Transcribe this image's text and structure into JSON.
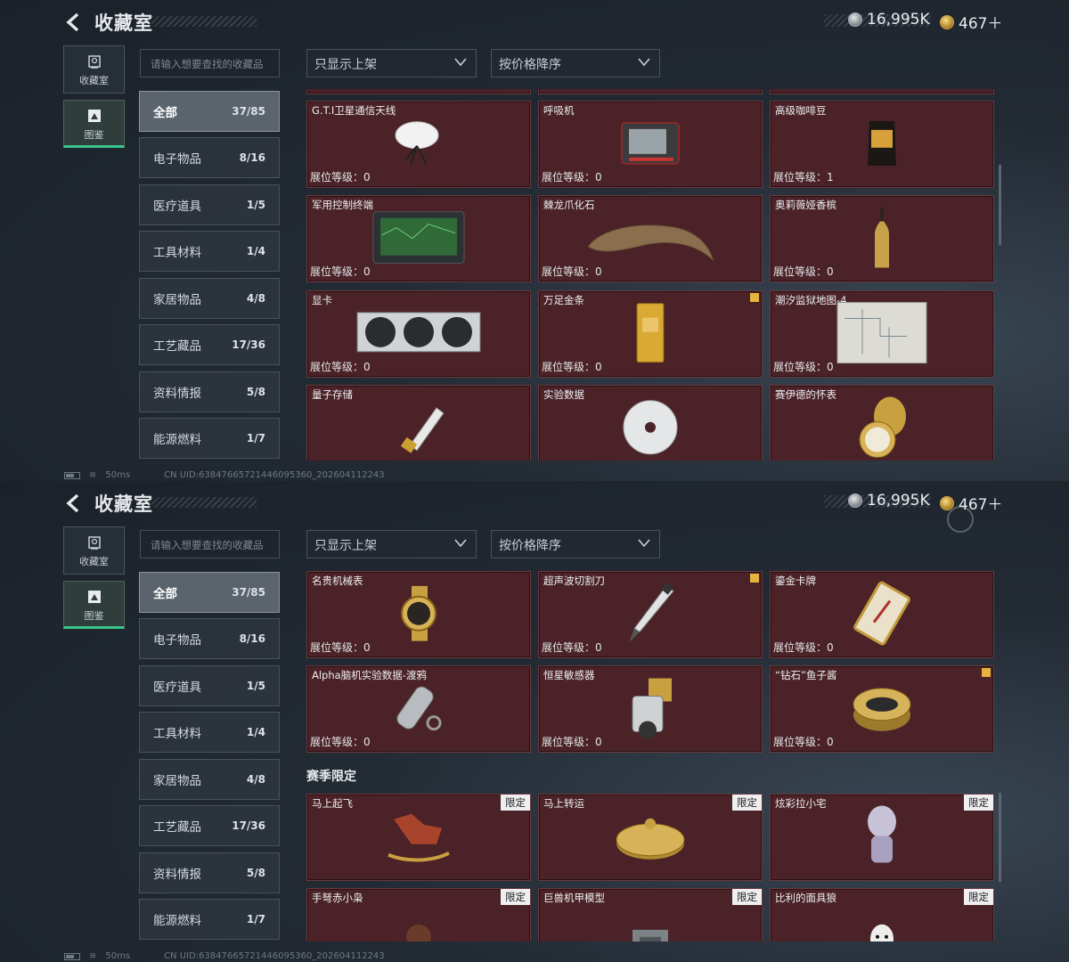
{
  "header": {
    "title": "收藏室",
    "silver_amount": "16,995K",
    "gold_amount": "467＋"
  },
  "left_nav": [
    {
      "label": "收藏室",
      "icon": "collection-room-icon"
    },
    {
      "label": "图鉴",
      "icon": "codex-icon"
    }
  ],
  "search": {
    "placeholder": "请输入想要查找的收藏品"
  },
  "filters": {
    "show_filter": "只显示上架",
    "sort": "按价格降序"
  },
  "categories": [
    {
      "label": "全部",
      "count": "37/85"
    },
    {
      "label": "电子物品",
      "count": "8/16"
    },
    {
      "label": "医疗道具",
      "count": "1/5"
    },
    {
      "label": "工具材料",
      "count": "1/4"
    },
    {
      "label": "家居物品",
      "count": "4/8"
    },
    {
      "label": "工艺藏品",
      "count": "17/36"
    },
    {
      "label": "资料情报",
      "count": "5/8"
    },
    {
      "label": "能源燃料",
      "count": "1/7"
    }
  ],
  "panel1_items": [
    {
      "name": "G.T.I卫星通信天线",
      "level": "展位等级：0",
      "icon": "satellite-dish-icon"
    },
    {
      "name": "呼吸机",
      "level": "展位等级：0",
      "icon": "ventilator-icon"
    },
    {
      "name": "高级咖啡豆",
      "level": "展位等级：1",
      "icon": "coffee-bag-icon"
    },
    {
      "name": "军用控制终端",
      "level": "展位等级：0",
      "icon": "terminal-icon"
    },
    {
      "name": "棘龙爪化石",
      "level": "展位等级：0",
      "icon": "claw-fossil-icon"
    },
    {
      "name": "奥莉薇娅香槟",
      "level": "展位等级：0",
      "icon": "champagne-icon"
    },
    {
      "name": "显卡",
      "level": "展位等级：0",
      "icon": "gpu-icon"
    },
    {
      "name": "万足金条",
      "level": "展位等级：0",
      "icon": "gold-bar-icon",
      "warn": true
    },
    {
      "name": "潮汐监狱地图-4",
      "level": "展位等级：0",
      "icon": "map-icon"
    },
    {
      "name": "量子存储",
      "level": "",
      "icon": "usb-drive-icon"
    },
    {
      "name": "实验数据",
      "level": "",
      "icon": "disc-icon"
    },
    {
      "name": "赛伊德的怀表",
      "level": "",
      "icon": "pocket-watch-icon"
    }
  ],
  "panel2_items": [
    {
      "name": "名贵机械表",
      "level": "展位等级：0",
      "icon": "wristwatch-icon"
    },
    {
      "name": "超声波切割刀",
      "level": "展位等级：0",
      "icon": "cutter-icon",
      "warn": true
    },
    {
      "name": "鎏金卡牌",
      "level": "展位等级：0",
      "icon": "gilded-card-icon"
    },
    {
      "name": "Alpha脑机实验数据-渡鸦",
      "level": "展位等级：0",
      "icon": "data-capsule-icon"
    },
    {
      "name": "恒星敏感器",
      "level": "展位等级：0",
      "icon": "sensor-icon"
    },
    {
      "name": "“钻石”鱼子酱",
      "level": "展位等级：0",
      "icon": "caviar-tin-icon",
      "warn": true
    }
  ],
  "season_title": "赛季限定",
  "limited_label": "限定",
  "season_items": [
    {
      "name": "马上起飞",
      "icon": "rocking-horse-icon"
    },
    {
      "name": "马上转运",
      "icon": "fortune-wheel-icon"
    },
    {
      "name": "炫彩拉小宅",
      "icon": "figurine-icon"
    },
    {
      "name": "手弩赤小枭",
      "icon": "hooded-figure-icon"
    },
    {
      "name": "巨兽机甲模型",
      "icon": "mech-model-icon"
    },
    {
      "name": "比利的面具狼",
      "icon": "puppet-mask-icon"
    }
  ],
  "footer": {
    "ping": "50ms",
    "uid": "CN UID:63847665721446095360_202604112243"
  },
  "colors": {
    "card_bg": "#4a2227",
    "accent_green": "#3cc48a",
    "warn_yellow": "#e6b43c"
  }
}
